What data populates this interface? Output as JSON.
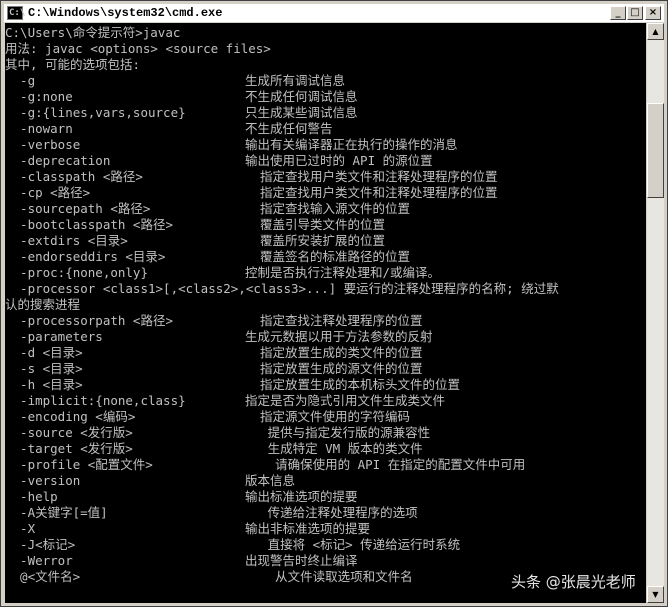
{
  "window": {
    "title": "C:\\Windows\\system32\\cmd.exe",
    "icon_label": "C:\\",
    "buttons": {
      "minimize": "_",
      "maximize": "□",
      "close": "×"
    }
  },
  "console": {
    "prompt": "C:\\Users\\命令提示符>javac",
    "usage": "用法: javac <options> <source files>",
    "intro": "其中, 可能的选项包括:",
    "options": [
      {
        "flag": "  -g",
        "desc": "生成所有调试信息"
      },
      {
        "flag": "  -g:none",
        "desc": "不生成任何调试信息"
      },
      {
        "flag": "  -g:{lines,vars,source}",
        "desc": "只生成某些调试信息"
      },
      {
        "flag": "  -nowarn",
        "desc": "不生成任何警告"
      },
      {
        "flag": "  -verbose",
        "desc": "输出有关编译器正在执行的操作的消息"
      },
      {
        "flag": "  -deprecation",
        "desc": "输出使用已过时的 API 的源位置"
      },
      {
        "flag": "  -classpath <路径>",
        "desc": "  指定查找用户类文件和注释处理程序的位置"
      },
      {
        "flag": "  -cp <路径>",
        "desc": "  指定查找用户类文件和注释处理程序的位置"
      },
      {
        "flag": "  -sourcepath <路径>",
        "desc": "  指定查找输入源文件的位置"
      },
      {
        "flag": "  -bootclasspath <路径>",
        "desc": "  覆盖引导类文件的位置"
      },
      {
        "flag": "  -extdirs <目录>",
        "desc": "  覆盖所安装扩展的位置"
      },
      {
        "flag": "  -endorseddirs <目录>",
        "desc": "  覆盖签名的标准路径的位置"
      },
      {
        "flag": "  -proc:{none,only}",
        "desc": "控制是否执行注释处理和/或编译。"
      }
    ],
    "processor_line": "  -processor <class1>[,<class2>,<class3>...] 要运行的注释处理程序的名称; 绕过默",
    "processor_wrap": "认的搜索进程",
    "options2": [
      {
        "flag": "  -processorpath <路径>",
        "desc": "  指定查找注释处理程序的位置"
      },
      {
        "flag": "  -parameters",
        "desc": "生成元数据以用于方法参数的反射"
      },
      {
        "flag": "  -d <目录>",
        "desc": "  指定放置生成的类文件的位置"
      },
      {
        "flag": "  -s <目录>",
        "desc": "  指定放置生成的源文件的位置"
      },
      {
        "flag": "  -h <目录>",
        "desc": "  指定放置生成的本机标头文件的位置"
      },
      {
        "flag": "  -implicit:{none,class}",
        "desc": "指定是否为隐式引用文件生成类文件"
      },
      {
        "flag": "  -encoding <编码>",
        "desc": "  指定源文件使用的字符编码"
      },
      {
        "flag": "  -source <发行版>",
        "desc": "   提供与指定发行版的源兼容性"
      },
      {
        "flag": "  -target <发行版>",
        "desc": "   生成特定 VM 版本的类文件"
      },
      {
        "flag": "  -profile <配置文件>",
        "desc": "    请确保使用的 API 在指定的配置文件中可用"
      },
      {
        "flag": "  -version",
        "desc": "版本信息"
      },
      {
        "flag": "  -help",
        "desc": "输出标准选项的提要"
      },
      {
        "flag": "  -A关键字[=值]",
        "desc": "   传递给注释处理程序的选项"
      },
      {
        "flag": "  -X",
        "desc": "输出非标准选项的提要"
      },
      {
        "flag": "  -J<标记>",
        "desc": "   直接将 <标记> 传递给运行时系统"
      },
      {
        "flag": "  -Werror",
        "desc": "出现警告时终止编译"
      },
      {
        "flag": "  @<文件名>",
        "desc": "    从文件读取选项和文件名"
      }
    ]
  },
  "scrollbar": {
    "up": "▲",
    "down": "▼"
  },
  "watermark": "头条 @张晨光老师"
}
